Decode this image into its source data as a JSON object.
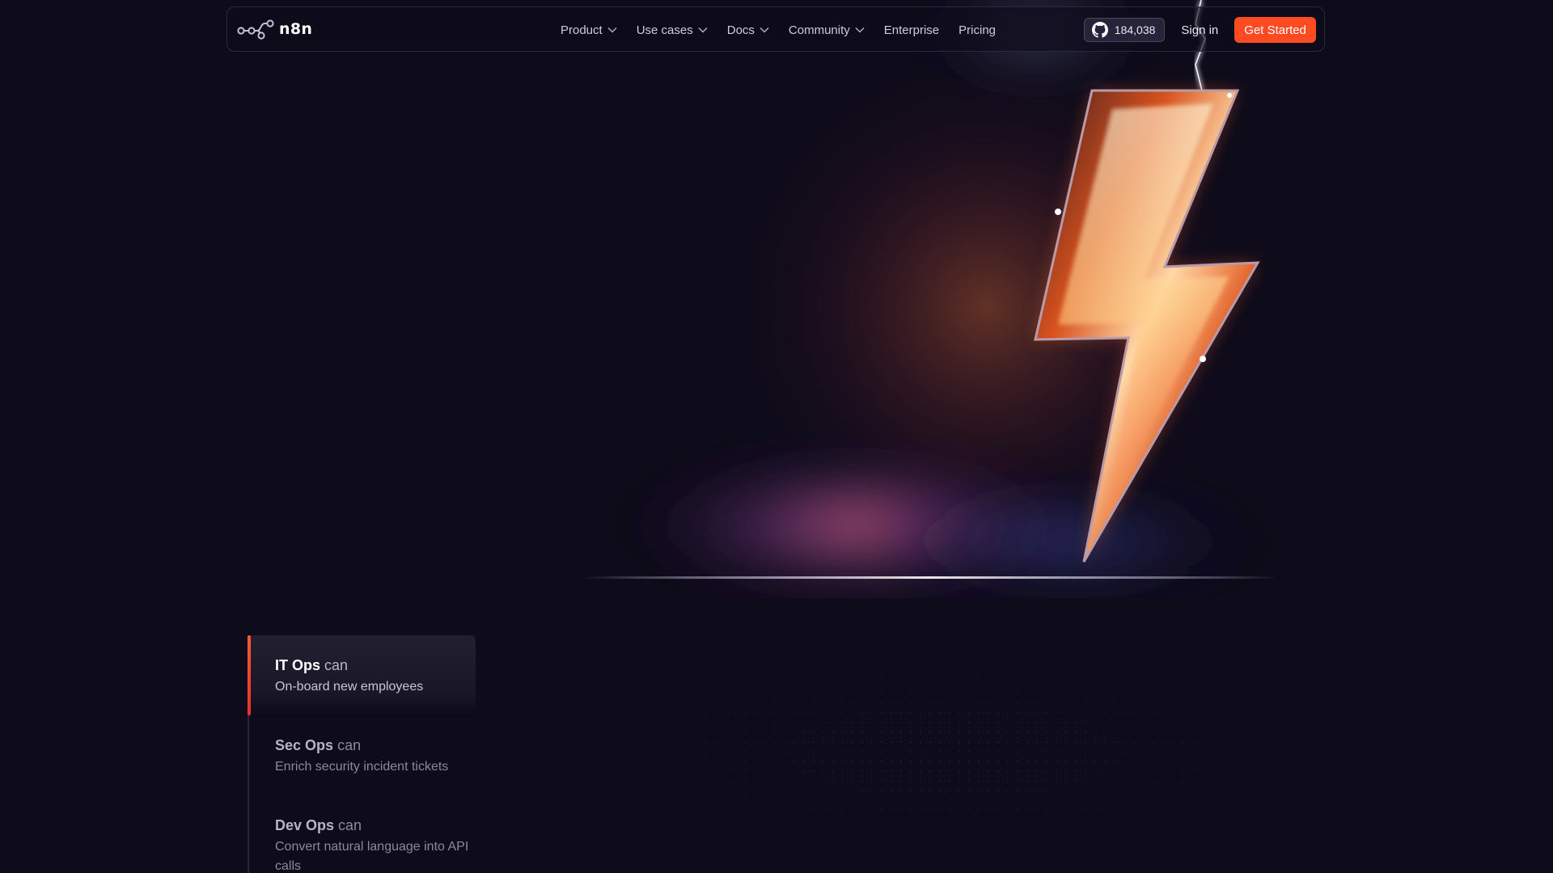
{
  "brand": {
    "name": "n8n",
    "accent": "#ff4b22"
  },
  "nav": {
    "items": [
      {
        "label": "Product",
        "has_dropdown": true
      },
      {
        "label": "Use cases",
        "has_dropdown": true
      },
      {
        "label": "Docs",
        "has_dropdown": true
      },
      {
        "label": "Community",
        "has_dropdown": true
      },
      {
        "label": "Enterprise",
        "has_dropdown": false
      },
      {
        "label": "Pricing",
        "has_dropdown": false
      }
    ],
    "github_stars": "184,038",
    "sign_in": "Sign in",
    "cta": "Get Started"
  },
  "use_cases": [
    {
      "team": "IT Ops",
      "can": "can",
      "desc": "On-board new employees",
      "active": true
    },
    {
      "team": "Sec Ops",
      "can": "can",
      "desc": "Enrich security incident tickets",
      "active": false
    },
    {
      "team": "Dev Ops",
      "can": "can",
      "desc": "Convert natural language into API calls",
      "active": false
    }
  ],
  "icons": {
    "logo": "n8n-logo-icon",
    "github": "github-icon",
    "dropdown": "chevron-down-icon"
  }
}
